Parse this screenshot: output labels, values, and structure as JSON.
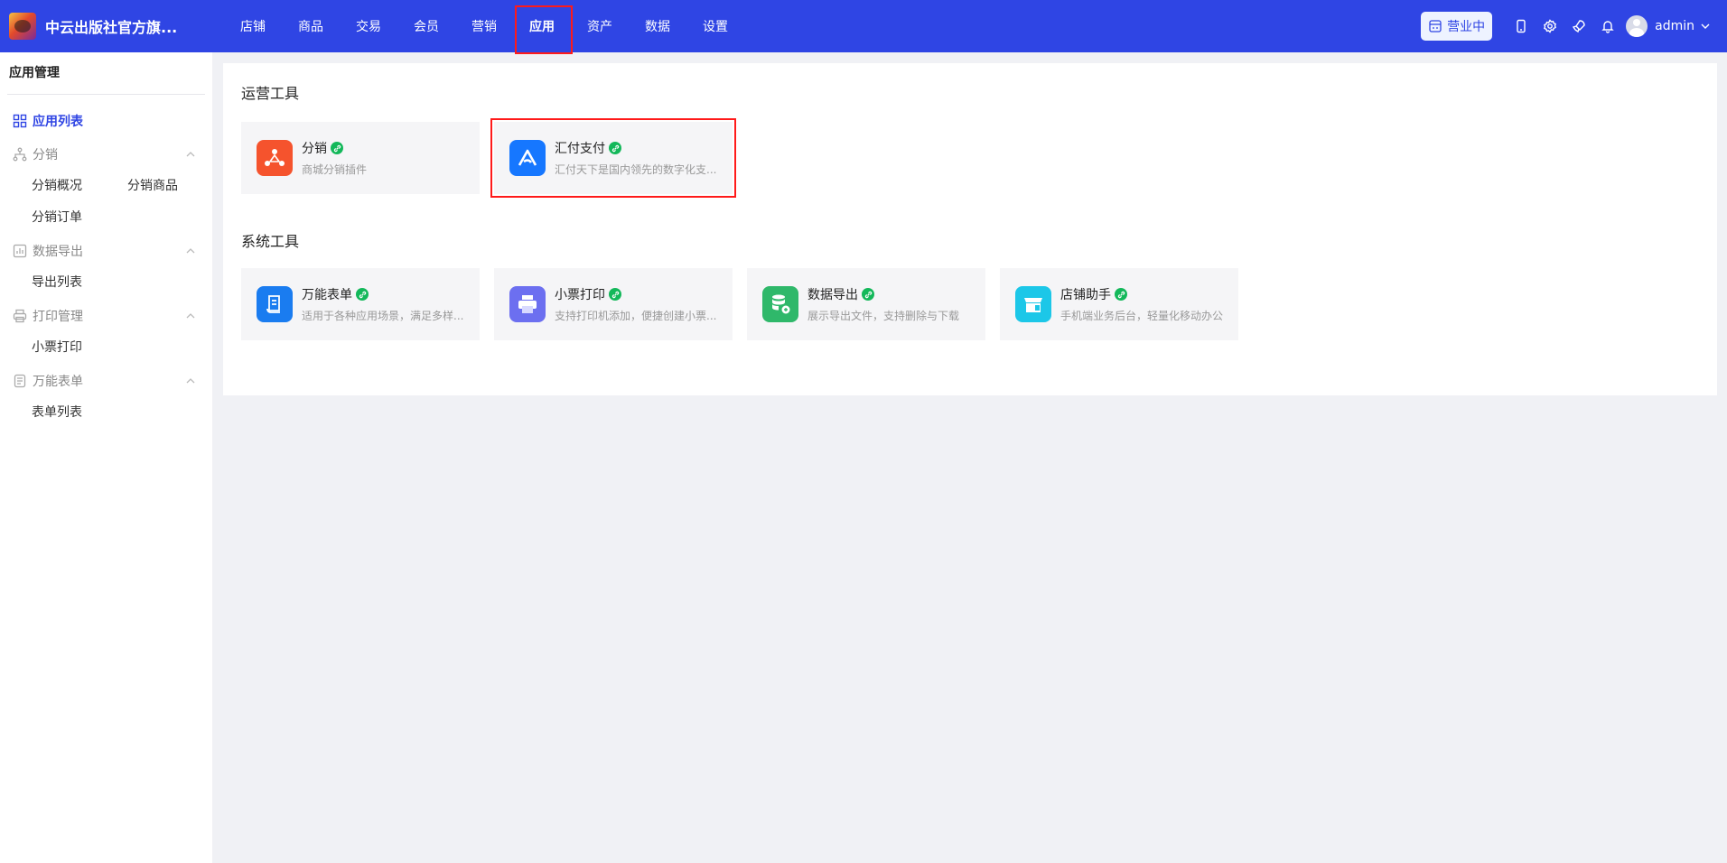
{
  "topbar": {
    "shop_name": "中云出版社官方旗...",
    "nav": [
      "店铺",
      "商品",
      "交易",
      "会员",
      "营销",
      "应用",
      "资产",
      "数据",
      "设置"
    ],
    "active_nav": "应用",
    "status_label": "营业中",
    "username": "admin",
    "colors": {
      "brand": "#2f45e4",
      "highlight": "#ff1a1a"
    }
  },
  "sidebar": {
    "title": "应用管理",
    "app_list": "应用列表",
    "groups": {
      "distribution": {
        "label": "分销",
        "items": [
          "分销概况",
          "分销商品",
          "分销订单"
        ]
      },
      "export": {
        "label": "数据导出",
        "items": [
          "导出列表"
        ]
      },
      "print": {
        "label": "打印管理",
        "items": [
          "小票打印"
        ]
      },
      "forms": {
        "label": "万能表单",
        "items": [
          "表单列表"
        ]
      }
    }
  },
  "main": {
    "ops_title": "运营工具",
    "sys_title": "系统工具",
    "ops_cards": [
      {
        "name": "分销",
        "desc": "商城分销插件",
        "icon": "distribution-icon",
        "color": "#f5532d"
      },
      {
        "name": "汇付支付",
        "desc": "汇付天下是国内领先的数字化支...",
        "icon": "huifu-pay-icon",
        "color": "#1677ff"
      }
    ],
    "sys_cards": [
      {
        "name": "万能表单",
        "desc": "适用于各种应用场景，满足多样...",
        "icon": "form-icon",
        "color": "#1a7cf0"
      },
      {
        "name": "小票打印",
        "desc": "支持打印机添加，便捷创建小票...",
        "icon": "printer-icon",
        "color": "#6c6ff0"
      },
      {
        "name": "数据导出",
        "desc": "展示导出文件，支持删除与下载",
        "icon": "database-export-icon",
        "color": "#2fb86a"
      },
      {
        "name": "店铺助手",
        "desc": "手机端业务后台，轻量化移动办公",
        "icon": "store-assistant-icon",
        "color": "#1cc7e8"
      }
    ]
  }
}
